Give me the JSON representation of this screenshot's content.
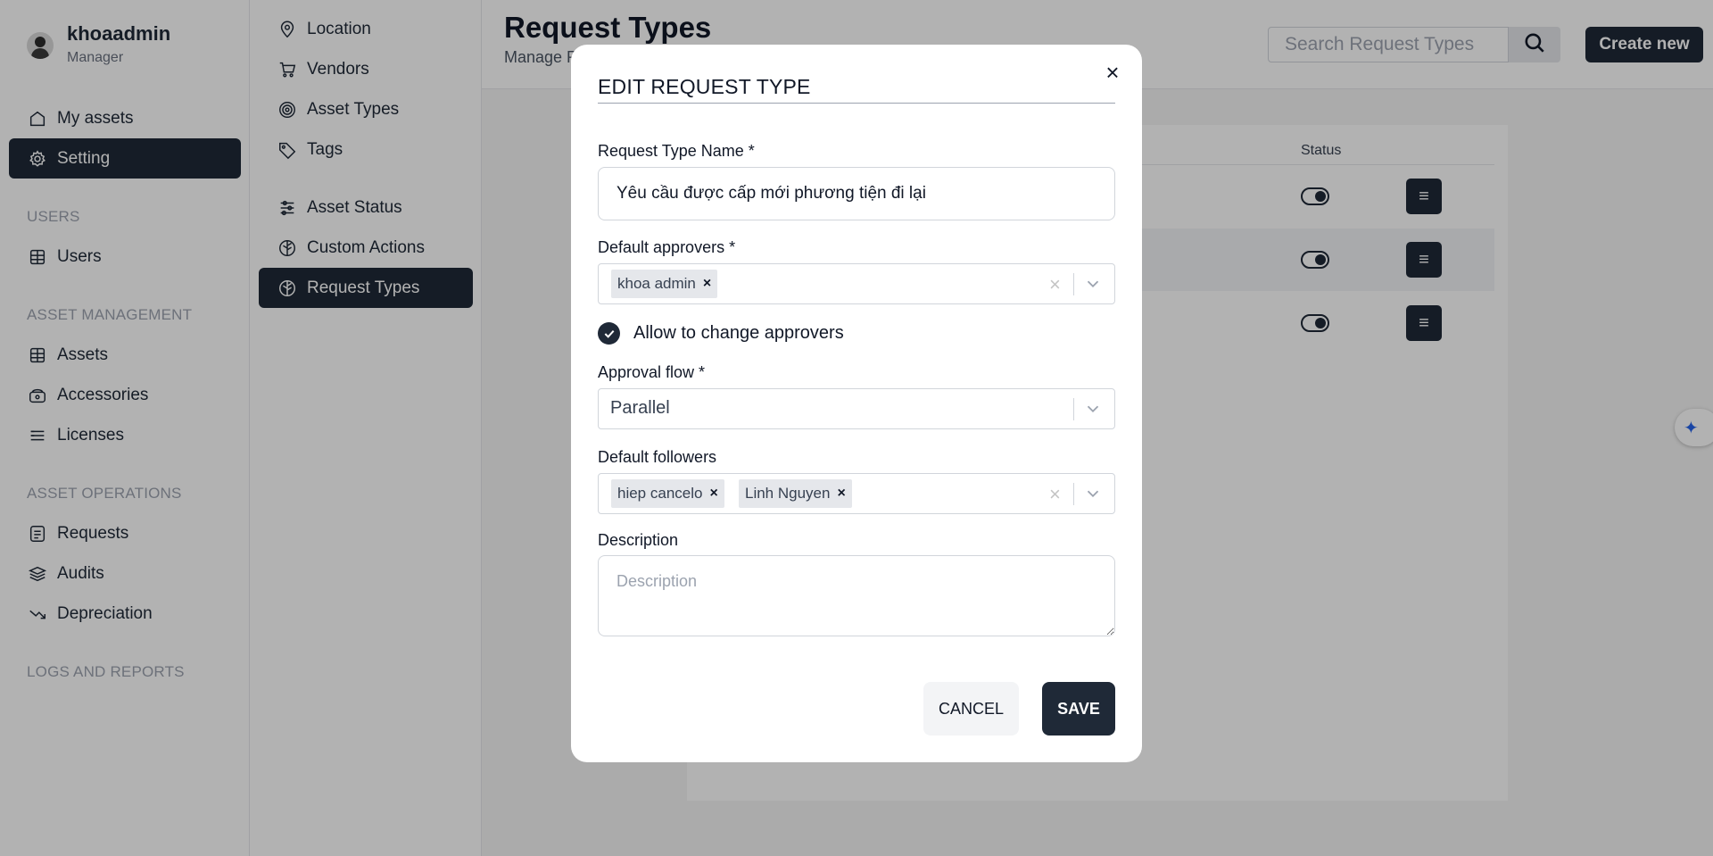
{
  "user": {
    "name": "khoaadmin",
    "role": "Manager"
  },
  "sidebar": {
    "top_items": [
      {
        "label": "My assets",
        "icon": "home-icon"
      },
      {
        "label": "Setting",
        "icon": "gear-icon"
      }
    ],
    "sections": [
      {
        "title": "USERS",
        "items": [
          {
            "label": "Users",
            "icon": "users-icon"
          }
        ]
      },
      {
        "title": "ASSET MANAGEMENT",
        "items": [
          {
            "label": "Assets",
            "icon": "assets-icon"
          },
          {
            "label": "Accessories",
            "icon": "accessories-icon"
          },
          {
            "label": "Licenses",
            "icon": "licenses-icon"
          }
        ]
      },
      {
        "title": "ASSET OPERATIONS",
        "items": [
          {
            "label": "Requests",
            "icon": "requests-icon"
          },
          {
            "label": "Audits",
            "icon": "audits-icon"
          },
          {
            "label": "Depreciation",
            "icon": "depreciation-icon"
          }
        ]
      },
      {
        "title": "LOGS AND REPORTS",
        "items": []
      }
    ]
  },
  "subnav": {
    "items": [
      {
        "label": "Location",
        "icon": "location-pin-icon"
      },
      {
        "label": "Vendors",
        "icon": "cart-icon"
      },
      {
        "label": "Asset Types",
        "icon": "target-icon"
      },
      {
        "label": "Tags",
        "icon": "tag-icon"
      },
      {
        "label": "Asset Status",
        "icon": "sliders-icon"
      },
      {
        "label": "Custom Actions",
        "icon": "leaf-icon"
      },
      {
        "label": "Request Types",
        "icon": "leaf-icon"
      }
    ]
  },
  "header": {
    "title": "Request Types",
    "subtitle": "Manage R",
    "search_placeholder": "Search Request Types",
    "create_label": "Create new"
  },
  "table": {
    "status_header": "Status",
    "rows": [
      {
        "status": true
      },
      {
        "status": true
      },
      {
        "status": true
      }
    ]
  },
  "modal": {
    "title": "EDIT REQUEST TYPE",
    "name_label": "Request Type Name *",
    "name_value": "Yêu cầu được cấp mới phương tiện đi lại",
    "approvers_label": "Default approvers *",
    "approvers": [
      "khoa admin"
    ],
    "allow_change_label": "Allow to change approvers",
    "allow_change_checked": true,
    "flow_label": "Approval flow *",
    "flow_value": "Parallel",
    "followers_label": "Default followers",
    "followers": [
      "hiep cancelo",
      "Linh Nguyen"
    ],
    "description_label": "Description",
    "description_placeholder": "Description",
    "cancel_label": "CANCEL",
    "save_label": "SAVE"
  },
  "colors": {
    "primary": "#1f2937",
    "overlay": "rgba(0,0,0,0.30)"
  }
}
